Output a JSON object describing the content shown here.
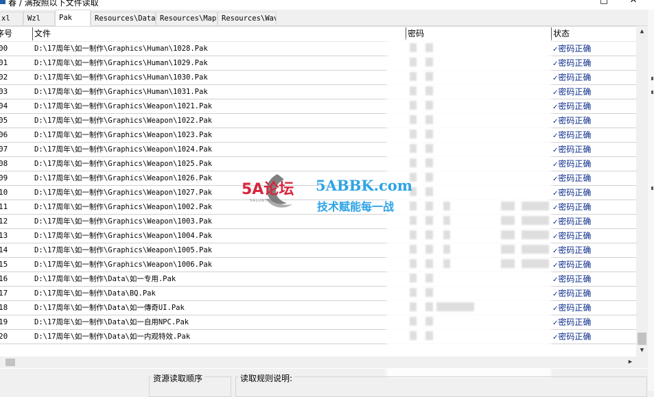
{
  "window": {
    "title": "春 / 满按照以下文件读取",
    "minimize_glyph": "□",
    "close_glyph": "✕"
  },
  "tabs": [
    {
      "label": "xl"
    },
    {
      "label": "Wzl"
    },
    {
      "label": "Pak"
    },
    {
      "label": "Resources\\Data"
    },
    {
      "label": "Resources\\Map"
    },
    {
      "label": "Resources\\Wav"
    }
  ],
  "active_tab": "Pak",
  "list": {
    "columns": {
      "num": "序号",
      "file": "文件",
      "password": "密码",
      "status": "状态"
    },
    "rows": [
      {
        "num": "00",
        "file": "D:\\17周年\\如一制作\\Graphics\\Human\\1028.Pak",
        "status": "密码正确"
      },
      {
        "num": "01",
        "file": "D:\\17周年\\如一制作\\Graphics\\Human\\1029.Pak",
        "status": "密码正确"
      },
      {
        "num": "02",
        "file": "D:\\17周年\\如一制作\\Graphics\\Human\\1030.Pak",
        "status": "密码正确"
      },
      {
        "num": "03",
        "file": "D:\\17周年\\如一制作\\Graphics\\Human\\1031.Pak",
        "status": "密码正确"
      },
      {
        "num": "04",
        "file": "D:\\17周年\\如一制作\\Graphics\\Weapon\\1021.Pak",
        "status": "密码正确"
      },
      {
        "num": "05",
        "file": "D:\\17周年\\如一制作\\Graphics\\Weapon\\1022.Pak",
        "status": "密码正确"
      },
      {
        "num": "06",
        "file": "D:\\17周年\\如一制作\\Graphics\\Weapon\\1023.Pak",
        "status": "密码正确"
      },
      {
        "num": "07",
        "file": "D:\\17周年\\如一制作\\Graphics\\Weapon\\1024.Pak",
        "status": "密码正确"
      },
      {
        "num": "08",
        "file": "D:\\17周年\\如一制作\\Graphics\\Weapon\\1025.Pak",
        "status": "密码正确"
      },
      {
        "num": "09",
        "file": "D:\\17周年\\如一制作\\Graphics\\Weapon\\1026.Pak",
        "status": "密码正确"
      },
      {
        "num": "10",
        "file": "D:\\17周年\\如一制作\\Graphics\\Weapon\\1027.Pak",
        "status": "密码正确"
      },
      {
        "num": "11",
        "file": "D:\\17周年\\如一制作\\Graphics\\Weapon\\1002.Pak",
        "status": "密码正确"
      },
      {
        "num": "12",
        "file": "D:\\17周年\\如一制作\\Graphics\\Weapon\\1003.Pak",
        "status": "密码正确"
      },
      {
        "num": "13",
        "file": "D:\\17周年\\如一制作\\Graphics\\Weapon\\1004.Pak",
        "status": "密码正确"
      },
      {
        "num": "14",
        "file": "D:\\17周年\\如一制作\\Graphics\\Weapon\\1005.Pak",
        "status": "密码正确"
      },
      {
        "num": "15",
        "file": "D:\\17周年\\如一制作\\Graphics\\Weapon\\1006.Pak",
        "status": "密码正确"
      },
      {
        "num": "16",
        "file": "D:\\17周年\\如一制作\\Data\\如一专用.Pak",
        "status": "密码正确"
      },
      {
        "num": "17",
        "file": "D:\\17周年\\如一制作\\Data\\BQ.Pak",
        "status": "密码正确"
      },
      {
        "num": "18",
        "file": "D:\\17周年\\如一制作\\Data\\如一傳奇UI.Pak",
        "status": "密码正确"
      },
      {
        "num": "19",
        "file": "D:\\17周年\\如一制作\\Data\\如一自用NPC.Pak",
        "status": "密码正确"
      },
      {
        "num": "20",
        "file": "D:\\17周年\\如一制作\\Data\\如一内观特效.Pak",
        "status": "密码正确"
      }
    ],
    "check_glyph": "✓"
  },
  "scrollbar": {
    "up": "▲",
    "down": "▼",
    "left": "◀",
    "right": "▶"
  },
  "bottom": {
    "resource_order_label": "资源读取顺序",
    "read_rules_label": "读取规则说明:"
  },
  "watermark": {
    "logo": "5A论坛",
    "logo_sub": "SALUNTAN",
    "site": "5ABBK.com",
    "slogan": "技术赋能每一战"
  },
  "colors": {
    "status_text": "#0a2c8c",
    "watermark_red": "#d7263d",
    "watermark_blue": "#2ea3e6"
  }
}
